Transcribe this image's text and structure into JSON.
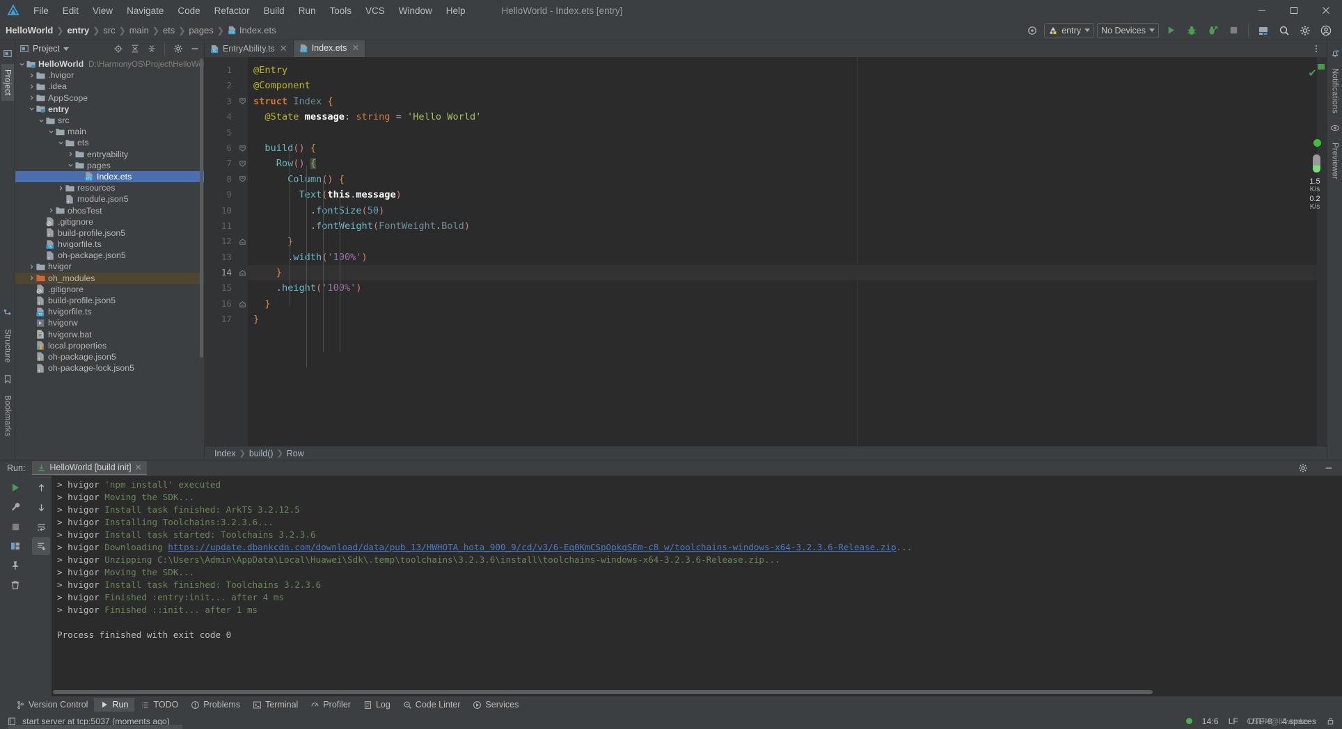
{
  "window": {
    "title": "HelloWorld - Index.ets [entry]",
    "controls": {
      "minimize": "—",
      "maximize": "☐",
      "close": "✕"
    }
  },
  "menubar": {
    "items": [
      "File",
      "Edit",
      "View",
      "Navigate",
      "Code",
      "Refactor",
      "Build",
      "Run",
      "Tools",
      "VCS",
      "Window",
      "Help"
    ]
  },
  "navbar": {
    "breadcrumb": [
      "HelloWorld",
      "entry",
      "src",
      "main",
      "ets",
      "pages",
      "Index.ets"
    ],
    "run_config": "entry",
    "device_selector": "No Devices",
    "icons": [
      "settings-eye-icon",
      "run-icon",
      "debug-icon",
      "profile-icon",
      "stop-icon",
      "device-manager-icon",
      "search-icon",
      "settings-icon",
      "account-icon"
    ]
  },
  "left_rail": {
    "tabs": [
      "Project",
      "Structure",
      "Bookmarks"
    ]
  },
  "right_rail": {
    "tabs": [
      "Notifications",
      "Previewer"
    ]
  },
  "project_panel": {
    "title": "Project",
    "header_buttons": [
      "locate-icon",
      "expand-all-icon",
      "collapse-all-icon",
      "settings-icon",
      "hide-icon"
    ],
    "tree": [
      {
        "depth": 0,
        "arrow": "v",
        "icon": "module-folder",
        "name": "HelloWorld",
        "bold": true,
        "path": "D:\\HarmonyOS\\Project\\HelloWorld"
      },
      {
        "depth": 1,
        "arrow": ">",
        "icon": "folder",
        "name": ".hvigor"
      },
      {
        "depth": 1,
        "arrow": ">",
        "icon": "folder",
        "name": ".idea"
      },
      {
        "depth": 1,
        "arrow": ">",
        "icon": "folder",
        "name": "AppScope"
      },
      {
        "depth": 1,
        "arrow": "v",
        "icon": "module-folder",
        "name": "entry",
        "bold": true
      },
      {
        "depth": 2,
        "arrow": "v",
        "icon": "folder",
        "name": "src"
      },
      {
        "depth": 3,
        "arrow": "v",
        "icon": "folder",
        "name": "main"
      },
      {
        "depth": 4,
        "arrow": "v",
        "icon": "folder",
        "name": "ets"
      },
      {
        "depth": 5,
        "arrow": ">",
        "icon": "folder",
        "name": "entryability"
      },
      {
        "depth": 5,
        "arrow": "v",
        "icon": "folder",
        "name": "pages"
      },
      {
        "depth": 6,
        "arrow": "",
        "icon": "ets-file",
        "name": "Index.ets",
        "selected": true
      },
      {
        "depth": 4,
        "arrow": ">",
        "icon": "folder",
        "name": "resources"
      },
      {
        "depth": 4,
        "arrow": "",
        "icon": "json5-file",
        "name": "module.json5"
      },
      {
        "depth": 3,
        "arrow": ">",
        "icon": "folder",
        "name": "ohosTest"
      },
      {
        "depth": 2,
        "arrow": "",
        "icon": "gitignore-file",
        "name": ".gitignore"
      },
      {
        "depth": 2,
        "arrow": "",
        "icon": "json5-file",
        "name": "build-profile.json5"
      },
      {
        "depth": 2,
        "arrow": "",
        "icon": "ts-file",
        "name": "hvigorfile.ts"
      },
      {
        "depth": 2,
        "arrow": "",
        "icon": "json5-file",
        "name": "oh-package.json5"
      },
      {
        "depth": 1,
        "arrow": ">",
        "icon": "folder",
        "name": "hvigor"
      },
      {
        "depth": 1,
        "arrow": ">",
        "icon": "folder-orange",
        "name": "oh_modules",
        "modified": true
      },
      {
        "depth": 1,
        "arrow": "",
        "icon": "gitignore-file",
        "name": ".gitignore"
      },
      {
        "depth": 1,
        "arrow": "",
        "icon": "json5-file",
        "name": "build-profile.json5"
      },
      {
        "depth": 1,
        "arrow": "",
        "icon": "ts-file",
        "name": "hvigorfile.ts"
      },
      {
        "depth": 1,
        "arrow": "",
        "icon": "script-file",
        "name": "hvigorw"
      },
      {
        "depth": 1,
        "arrow": "",
        "icon": "bat-file",
        "name": "hvigorw.bat"
      },
      {
        "depth": 1,
        "arrow": "",
        "icon": "properties-file",
        "name": "local.properties"
      },
      {
        "depth": 1,
        "arrow": "",
        "icon": "json5-file",
        "name": "oh-package.json5"
      },
      {
        "depth": 1,
        "arrow": "",
        "icon": "json5-file",
        "name": "oh-package-lock.json5"
      }
    ]
  },
  "editor": {
    "tabs": [
      {
        "label": "EntryAbility.ts",
        "icon": "ts-file",
        "active": false
      },
      {
        "label": "Index.ets",
        "icon": "ets-file",
        "active": true
      }
    ],
    "line_numbers": [
      "1",
      "2",
      "3",
      "4",
      "5",
      "6",
      "7",
      "8",
      "9",
      "10",
      "11",
      "12",
      "13",
      "14",
      "15",
      "16",
      "17"
    ],
    "current_line": 14,
    "code_lines": [
      "@Entry",
      "@Component",
      "struct Index {",
      "  @State message: string = 'Hello World'",
      "",
      "  build() {",
      "    Row() {",
      "      Column() {",
      "        Text(this.message)",
      "          .fontSize(50)",
      "          .fontWeight(FontWeight.Bold)",
      "      }",
      "      .width('100%')",
      "    }",
      "    .height('100%')",
      "  }",
      "}"
    ],
    "breadcrumb": [
      "Index",
      "build()",
      "Row"
    ],
    "caret_position": "14:6"
  },
  "run_panel": {
    "label": "Run:",
    "tab": "HelloWorld [build init]",
    "side_buttons": [
      "rerun-icon",
      "wrench-icon",
      "stop-icon",
      "layout-icon",
      "pin-icon",
      "trash-icon"
    ],
    "side_buttons2": [
      "scroll-up-icon",
      "scroll-down-icon",
      "soft-wrap-icon",
      "scroll-end-icon"
    ],
    "console": [
      {
        "prefix": "> hvigor ",
        "text": "'npm install' executed",
        "style": "g"
      },
      {
        "prefix": "> hvigor ",
        "text": "Moving the SDK...",
        "style": "g"
      },
      {
        "prefix": "> hvigor ",
        "text": "Install task finished: ArkTS 3.2.12.5",
        "style": "g"
      },
      {
        "prefix": "> hvigor ",
        "text": "Installing Toolchains:3.2.3.6...",
        "style": "g"
      },
      {
        "prefix": "> hvigor ",
        "text": "Install task started: Toolchains 3.2.3.6",
        "style": "g"
      },
      {
        "prefix": "> hvigor ",
        "text": "Downloading ",
        "style": "g",
        "link": "https://update.dbankcdn.com/download/data/pub_13/HWHOTA_hota_900_9/cd/v3/6-Eq0KmCSpOpkqSEm-c8_w/toolchains-windows-x64-3.2.3.6-Release.zip",
        "suffix": "..."
      },
      {
        "prefix": "> hvigor ",
        "text": "Unzipping C:\\Users\\Admin\\AppData\\Local\\Huawei\\Sdk\\.temp\\toolchains\\3.2.3.6\\install\\toolchains-windows-x64-3.2.3.6-Release.zip...",
        "style": "g"
      },
      {
        "prefix": "> hvigor ",
        "text": "Moving the SDK...",
        "style": "g"
      },
      {
        "prefix": "> hvigor ",
        "text": "Install task finished: Toolchains 3.2.3.6",
        "style": "g"
      },
      {
        "prefix": "> hvigor ",
        "text": "Finished :entry:init... after 4 ms",
        "style": "g"
      },
      {
        "prefix": "> hvigor ",
        "text": "Finished ::init... after 1 ms",
        "style": "g"
      },
      {
        "prefix": "",
        "text": "",
        "style": "g"
      },
      {
        "prefix": "",
        "text": "Process finished with exit code 0",
        "style": "w"
      }
    ]
  },
  "toolwindow_bar": {
    "items": [
      {
        "label": "Version Control",
        "icon": "branch-icon",
        "active": false
      },
      {
        "label": "Run",
        "icon": "run-icon",
        "active": true
      },
      {
        "label": "TODO",
        "icon": "todo-icon",
        "active": false
      },
      {
        "label": "Problems",
        "icon": "problems-icon",
        "active": false
      },
      {
        "label": "Terminal",
        "icon": "terminal-icon",
        "active": false
      },
      {
        "label": "Profiler",
        "icon": "profiler-icon",
        "active": false
      },
      {
        "label": "Log",
        "icon": "log-icon",
        "active": false
      },
      {
        "label": "Code Linter",
        "icon": "linter-icon",
        "active": false
      },
      {
        "label": "Services",
        "icon": "services-icon",
        "active": false
      }
    ]
  },
  "statusbar": {
    "message": "start server at tcp:5037 (moments ago)",
    "caret": "14:6",
    "line_sep": "LF",
    "encoding": "UTF-8",
    "indent": "4 spaces",
    "watermark": "CSDN@lilwenke"
  },
  "network_widget": {
    "upload": "1.5",
    "upload_unit": "K/s",
    "download": "0.2",
    "download_unit": "K/s"
  },
  "colors": {
    "bg": "#3c3f41",
    "editor_bg": "#2b2b2b",
    "accent": "#4b6eaf",
    "green": "#6a8759",
    "orange": "#cc7832",
    "string": "#a5c261",
    "number": "#6897bb",
    "modified": "#4f4632"
  }
}
